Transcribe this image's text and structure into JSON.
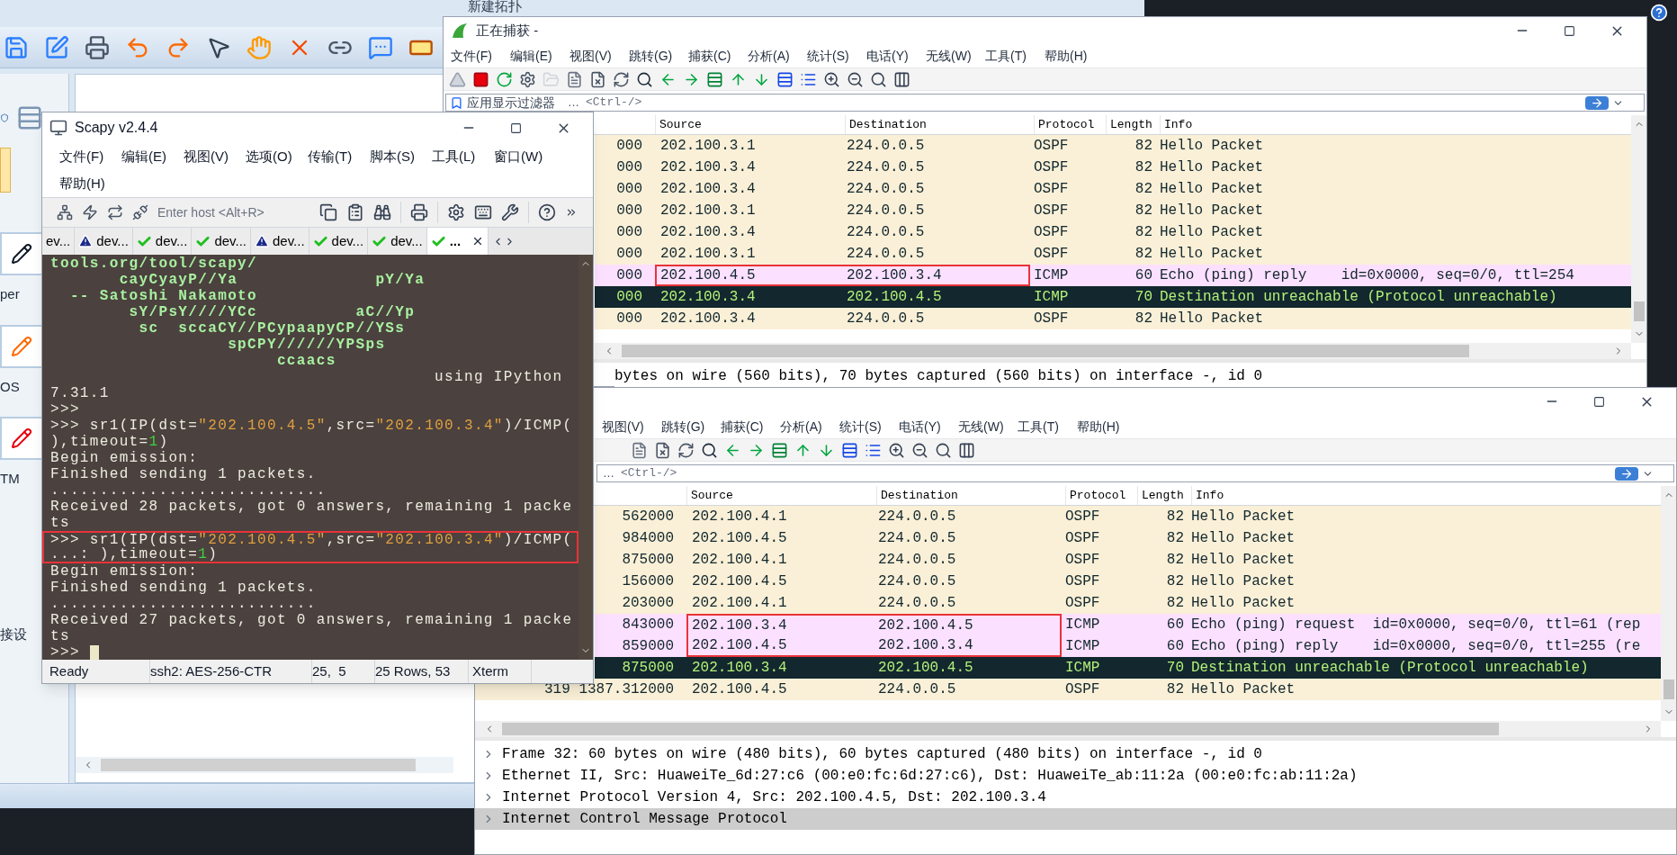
{
  "ensp": {
    "tab_title": "新建拓扑",
    "device_labels": [
      "per",
      "OS",
      "TM",
      "接设"
    ]
  },
  "capture_top": {
    "title": "正在捕获 -",
    "menu": [
      "文件(F)",
      "编辑(E)",
      "视图(V)",
      "跳转(G)",
      "捕获(C)",
      "分析(A)",
      "统计(S)",
      "电话(Y)",
      "无线(W)",
      "工具(T)",
      "帮助(H)"
    ],
    "filter_label": "应用显示过滤器",
    "filter_ellipsis": "…",
    "filter_hint": "<Ctrl-/>",
    "columns": [
      "Source",
      "Destination",
      "Protocol",
      "Length",
      "Info"
    ],
    "rows": [
      {
        "no_time": "000",
        "source": "202.100.3.1",
        "destination": "224.0.0.5",
        "protocol": "OSPF",
        "length": "82",
        "info": "Hello Packet",
        "color": "#faf0d7",
        "kind": "normal",
        "marked": false
      },
      {
        "no_time": "000",
        "source": "202.100.3.4",
        "destination": "224.0.0.5",
        "protocol": "OSPF",
        "length": "82",
        "info": "Hello Packet",
        "color": "#faf0d7",
        "kind": "normal",
        "marked": false
      },
      {
        "no_time": "000",
        "source": "202.100.3.4",
        "destination": "224.0.0.5",
        "protocol": "OSPF",
        "length": "82",
        "info": "Hello Packet",
        "color": "#faf0d7",
        "kind": "normal",
        "marked": false
      },
      {
        "no_time": "000",
        "source": "202.100.3.1",
        "destination": "224.0.0.5",
        "protocol": "OSPF",
        "length": "82",
        "info": "Hello Packet",
        "color": "#faf0d7",
        "kind": "normal",
        "marked": false
      },
      {
        "no_time": "000",
        "source": "202.100.3.4",
        "destination": "224.0.0.5",
        "protocol": "OSPF",
        "length": "82",
        "info": "Hello Packet",
        "color": "#faf0d7",
        "kind": "normal",
        "marked": false
      },
      {
        "no_time": "000",
        "source": "202.100.3.1",
        "destination": "224.0.0.5",
        "protocol": "OSPF",
        "length": "82",
        "info": "Hello Packet",
        "color": "#faf0d7",
        "kind": "normal",
        "marked": false
      },
      {
        "no_time": "000",
        "source": "202.100.4.5",
        "destination": "202.100.3.4",
        "protocol": "ICMP",
        "length": "60",
        "info": "Echo (ping) reply    id=0x0000, seq=0/0, ttl=254",
        "color": "#fce0ff",
        "kind": "normal",
        "marked": true
      },
      {
        "no_time": "000",
        "source": "202.100.3.4",
        "destination": "202.100.4.5",
        "protocol": "ICMP",
        "length": "70",
        "info": "Destination unreachable (Protocol unreachable)",
        "color": "#12272e",
        "kind": "error",
        "marked": false
      },
      {
        "no_time": "000",
        "source": "202.100.3.4",
        "destination": "224.0.0.5",
        "protocol": "OSPF",
        "length": "82",
        "info": "Hello Packet",
        "color": "#faf0d7",
        "kind": "normal",
        "marked": false
      }
    ],
    "details": [
      {
        "text": "bytes on wire (560 bits), 70 bytes captured (560 bits) on interface -, id 0",
        "selected": false
      }
    ]
  },
  "capture_bottom": {
    "menu": [
      "视图(V)",
      "跳转(G)",
      "捕获(C)",
      "分析(A)",
      "统计(S)",
      "电话(Y)",
      "无线(W)",
      "工具(T)",
      "帮助(H)"
    ],
    "filter_ellipsis": "…",
    "filter_hint": "<Ctrl-/>",
    "columns": [
      "Source",
      "Destination",
      "Protocol",
      "Length",
      "Info"
    ],
    "rows": [
      {
        "no_time": "562000",
        "source": "202.100.4.1",
        "destination": "224.0.0.5",
        "protocol": "OSPF",
        "length": "82",
        "info": "Hello Packet",
        "color": "#faf0d7",
        "kind": "normal",
        "marked": false
      },
      {
        "no_time": "984000",
        "source": "202.100.4.5",
        "destination": "224.0.0.5",
        "protocol": "OSPF",
        "length": "82",
        "info": "Hello Packet",
        "color": "#faf0d7",
        "kind": "normal",
        "marked": false
      },
      {
        "no_time": "875000",
        "source": "202.100.4.1",
        "destination": "224.0.0.5",
        "protocol": "OSPF",
        "length": "82",
        "info": "Hello Packet",
        "color": "#faf0d7",
        "kind": "normal",
        "marked": false
      },
      {
        "no_time": "156000",
        "source": "202.100.4.5",
        "destination": "224.0.0.5",
        "protocol": "OSPF",
        "length": "82",
        "info": "Hello Packet",
        "color": "#faf0d7",
        "kind": "normal",
        "marked": false
      },
      {
        "no_time": "203000",
        "source": "202.100.4.1",
        "destination": "224.0.0.5",
        "protocol": "OSPF",
        "length": "82",
        "info": "Hello Packet",
        "color": "#faf0d7",
        "kind": "normal",
        "marked": false
      },
      {
        "no_time": "843000",
        "source": "202.100.3.4",
        "destination": "202.100.4.5",
        "protocol": "ICMP",
        "length": "60",
        "info": "Echo (ping) request  id=0x0000, seq=0/0, ttl=61 (rep",
        "color": "#fce0ff",
        "kind": "normal",
        "marked": true
      },
      {
        "no_time": "859000",
        "source": "202.100.4.5",
        "destination": "202.100.3.4",
        "protocol": "ICMP",
        "length": "60",
        "info": "Echo (ping) reply    id=0x0000, seq=0/0, ttl=255 (re",
        "color": "#fce0ff",
        "kind": "normal",
        "marked": true
      },
      {
        "no_time": "875000",
        "source": "202.100.3.4",
        "destination": "202.100.4.5",
        "protocol": "ICMP",
        "length": "70",
        "info": "Destination unreachable (Protocol unreachable)",
        "color": "#12272e",
        "kind": "error",
        "marked": false
      },
      {
        "no_time": "319 1387.312000",
        "source": "202.100.4.5",
        "destination": "224.0.0.5",
        "protocol": "OSPF",
        "length": "82",
        "info": "Hello Packet",
        "color": "#faf0d7",
        "kind": "normal",
        "marked": false
      }
    ],
    "details": [
      {
        "text": "Frame 32: 60 bytes on wire (480 bits), 60 bytes captured (480 bits) on interface -, id 0",
        "selected": false
      },
      {
        "text": "Ethernet II, Src: HuaweiTe_6d:27:c6 (00:e0:fc:6d:27:c6), Dst: HuaweiTe_ab:11:2a (00:e0:fc:ab:11:2a)",
        "selected": false
      },
      {
        "text": "Internet Protocol Version 4, Src: 202.100.4.5, Dst: 202.100.3.4",
        "selected": false
      },
      {
        "text": "Internet Control Message Protocol",
        "selected": true
      }
    ]
  },
  "scapy": {
    "title": "Scapy v2.4.4",
    "menu": [
      "文件(F)",
      "编辑(E)",
      "视图(V)",
      "选项(O)",
      "传输(T)",
      "脚本(S)",
      "工具(L)",
      "窗口(W)",
      "帮助(H)"
    ],
    "host_placeholder": "Enter host <Alt+R>",
    "tabs": [
      {
        "label": "ev...",
        "kind": "none",
        "selected": false
      },
      {
        "label": "dev...",
        "kind": "warning",
        "selected": false
      },
      {
        "label": "dev...",
        "kind": "ok",
        "selected": false
      },
      {
        "label": "dev...",
        "kind": "ok",
        "selected": false
      },
      {
        "label": "dev...",
        "kind": "warning",
        "selected": false
      },
      {
        "label": "dev...",
        "kind": "ok",
        "selected": false
      },
      {
        "label": "dev...",
        "kind": "ok",
        "selected": false
      },
      {
        "label": "...",
        "kind": "ok",
        "selected": true
      }
    ],
    "lines": [
      {
        "segments": [
          {
            "text": "tools.org/tool/scapy/",
            "kind": "banner"
          }
        ],
        "marked": false
      },
      {
        "segments": [
          {
            "text": "       cayCyayP//Ya              pY/Ya",
            "kind": "banner"
          }
        ],
        "marked": false
      },
      {
        "segments": [
          {
            "text": "  -- Satoshi Nakamoto",
            "kind": "banner"
          }
        ],
        "marked": false
      },
      {
        "segments": [
          {
            "text": "        sY/PsY////YCc          aC//Yp",
            "kind": "banner"
          }
        ],
        "marked": false
      },
      {
        "segments": [
          {
            "text": "         sc  sccaCY//PCypaapyCP//YSs",
            "kind": "banner"
          }
        ],
        "marked": false
      },
      {
        "segments": [
          {
            "text": "                  spCPY//////YPSps",
            "kind": "banner"
          }
        ],
        "marked": false
      },
      {
        "segments": [
          {
            "text": "                       ccaacs",
            "kind": "banner"
          }
        ],
        "marked": false
      },
      {
        "segments": [
          {
            "text": "                                       using IPython",
            "kind": "plain"
          }
        ],
        "marked": false
      },
      {
        "segments": [
          {
            "text": "7.31.1",
            "kind": "plain"
          }
        ],
        "marked": false
      },
      {
        "segments": [
          {
            "text": ">>>",
            "kind": "plain"
          }
        ],
        "marked": false
      },
      {
        "segments": [
          {
            "text": ">>> sr1(IP(dst=",
            "kind": "plain"
          },
          {
            "text": "\"202.100.4.5\"",
            "kind": "string"
          },
          {
            "text": ",src=",
            "kind": "plain"
          },
          {
            "text": "\"202.100.3.4\"",
            "kind": "string"
          },
          {
            "text": ")/ICMP(",
            "kind": "plain"
          }
        ],
        "marked": false
      },
      {
        "segments": [
          {
            "text": "),timeout=",
            "kind": "plain"
          },
          {
            "text": "1",
            "kind": "number"
          },
          {
            "text": ")",
            "kind": "plain"
          }
        ],
        "marked": false
      },
      {
        "segments": [
          {
            "text": "Begin emission:",
            "kind": "plain"
          }
        ],
        "marked": false
      },
      {
        "segments": [
          {
            "text": "Finished sending 1 packets.",
            "kind": "plain"
          }
        ],
        "marked": false
      },
      {
        "segments": [
          {
            "text": "............................",
            "kind": "plain"
          }
        ],
        "marked": false
      },
      {
        "segments": [
          {
            "text": "Received 28 packets, got 0 answers, remaining 1 packe",
            "kind": "plain"
          }
        ],
        "marked": false
      },
      {
        "segments": [
          {
            "text": "ts",
            "kind": "plain"
          }
        ],
        "marked": false
      },
      {
        "segments": [
          {
            "text": ">>> sr1(IP(dst=",
            "kind": "plain"
          },
          {
            "text": "\"202.100.4.5\"",
            "kind": "string"
          },
          {
            "text": ",src=",
            "kind": "plain"
          },
          {
            "text": "\"202.100.3.4\"",
            "kind": "string"
          },
          {
            "text": ")/ICMP(",
            "kind": "plain"
          }
        ],
        "marked": true
      },
      {
        "segments": [
          {
            "text": "...: ),timeout=",
            "kind": "plain"
          },
          {
            "text": "1",
            "kind": "number"
          },
          {
            "text": ")",
            "kind": "plain"
          }
        ],
        "marked": true
      },
      {
        "segments": [
          {
            "text": "Begin emission:",
            "kind": "plain"
          }
        ],
        "marked": false
      },
      {
        "segments": [
          {
            "text": "Finished sending 1 packets.",
            "kind": "plain"
          }
        ],
        "marked": false
      },
      {
        "segments": [
          {
            "text": "...........................",
            "kind": "plain"
          }
        ],
        "marked": false
      },
      {
        "segments": [
          {
            "text": "Received 27 packets, got 0 answers, remaining 1 packe",
            "kind": "plain"
          }
        ],
        "marked": false
      },
      {
        "segments": [
          {
            "text": "ts",
            "kind": "plain"
          }
        ],
        "marked": false
      },
      {
        "segments": [
          {
            "text": ">>>",
            "kind": "plain"
          }
        ],
        "marked": false,
        "cursor": true
      }
    ],
    "status": [
      "Ready",
      "ssh2: AES-256-CTR",
      "25,  5",
      "25 Rows, 53",
      "Xterm"
    ]
  }
}
